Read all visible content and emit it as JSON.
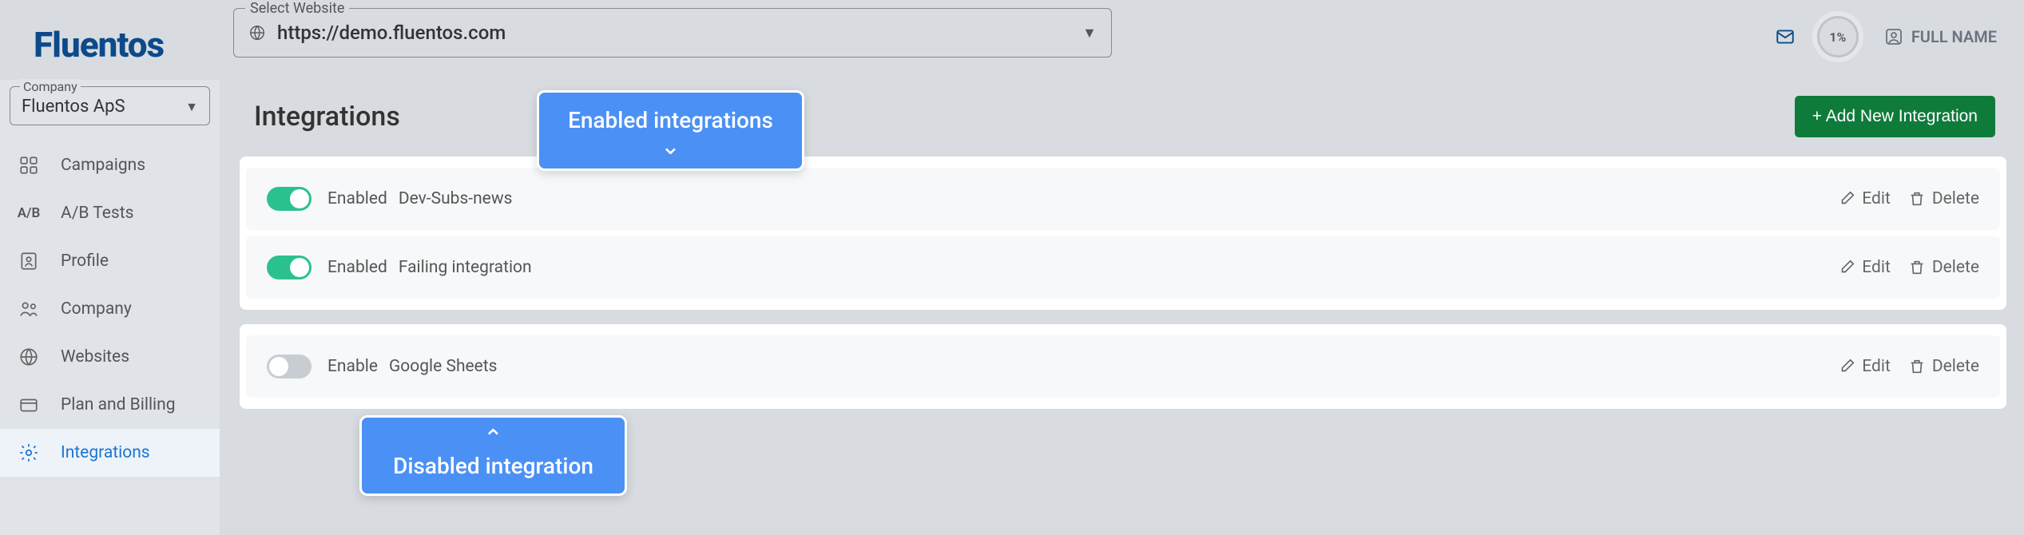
{
  "brand": "Fluentos",
  "website_selector": {
    "label": "Select Website",
    "value": "https://demo.fluentos.com"
  },
  "top_right": {
    "progress": "1%",
    "user_name": "FULL NAME"
  },
  "company": {
    "label": "Company",
    "value": "Fluentos ApS"
  },
  "nav": {
    "campaigns": "Campaigns",
    "ab_tests": "A/B Tests",
    "ab_icon": "A/B",
    "profile": "Profile",
    "company": "Company",
    "websites": "Websites",
    "plan_billing": "Plan and Billing",
    "integrations": "Integrations"
  },
  "page": {
    "title": "Integrations",
    "add_button": "+ Add New Integration"
  },
  "rows": {
    "r0": {
      "state": "Enabled",
      "name": "Dev-Subs-news"
    },
    "r1": {
      "state": "Enabled",
      "name": "Failing integration"
    },
    "r2": {
      "state": "Enable",
      "name": "Google Sheets"
    }
  },
  "actions": {
    "edit": "Edit",
    "delete": "Delete"
  },
  "callouts": {
    "enabled": "Enabled integrations",
    "disabled": "Disabled integration"
  }
}
